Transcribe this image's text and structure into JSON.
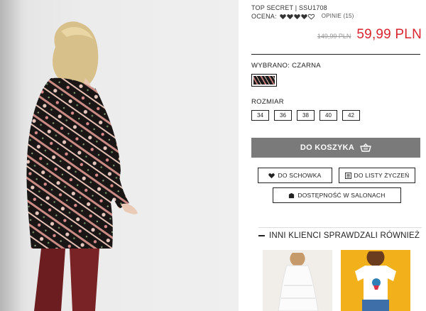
{
  "product": {
    "brand_sku": "TOP SECRET | SSU1708",
    "rating_label": "OCENA:",
    "rating_value": 4,
    "rating_max": 5,
    "reviews": "OPINIE (15)",
    "old_price": "149,99 PLN",
    "new_price": "59,99 PLN"
  },
  "color": {
    "selected_label": "WYBRANO: CZARNA",
    "swatch_icon": "pattern-swatch-icon"
  },
  "size": {
    "label": "ROZMIAR",
    "options": [
      "34",
      "36",
      "38",
      "40",
      "42"
    ]
  },
  "actions": {
    "add_to_cart": "DO KOSZYKA",
    "save": "DO SCHOWKA",
    "wishlist": "DO LISTY ŻYCZEŃ",
    "availability": "DOSTĘPNOŚĆ W SALONACH"
  },
  "others": {
    "title": "INNI KLIENCI SPRAWDZALI RÓWNIEŻ"
  },
  "colors": {
    "accent_price": "#d9252f",
    "cart_button": "#7a7a7a"
  }
}
